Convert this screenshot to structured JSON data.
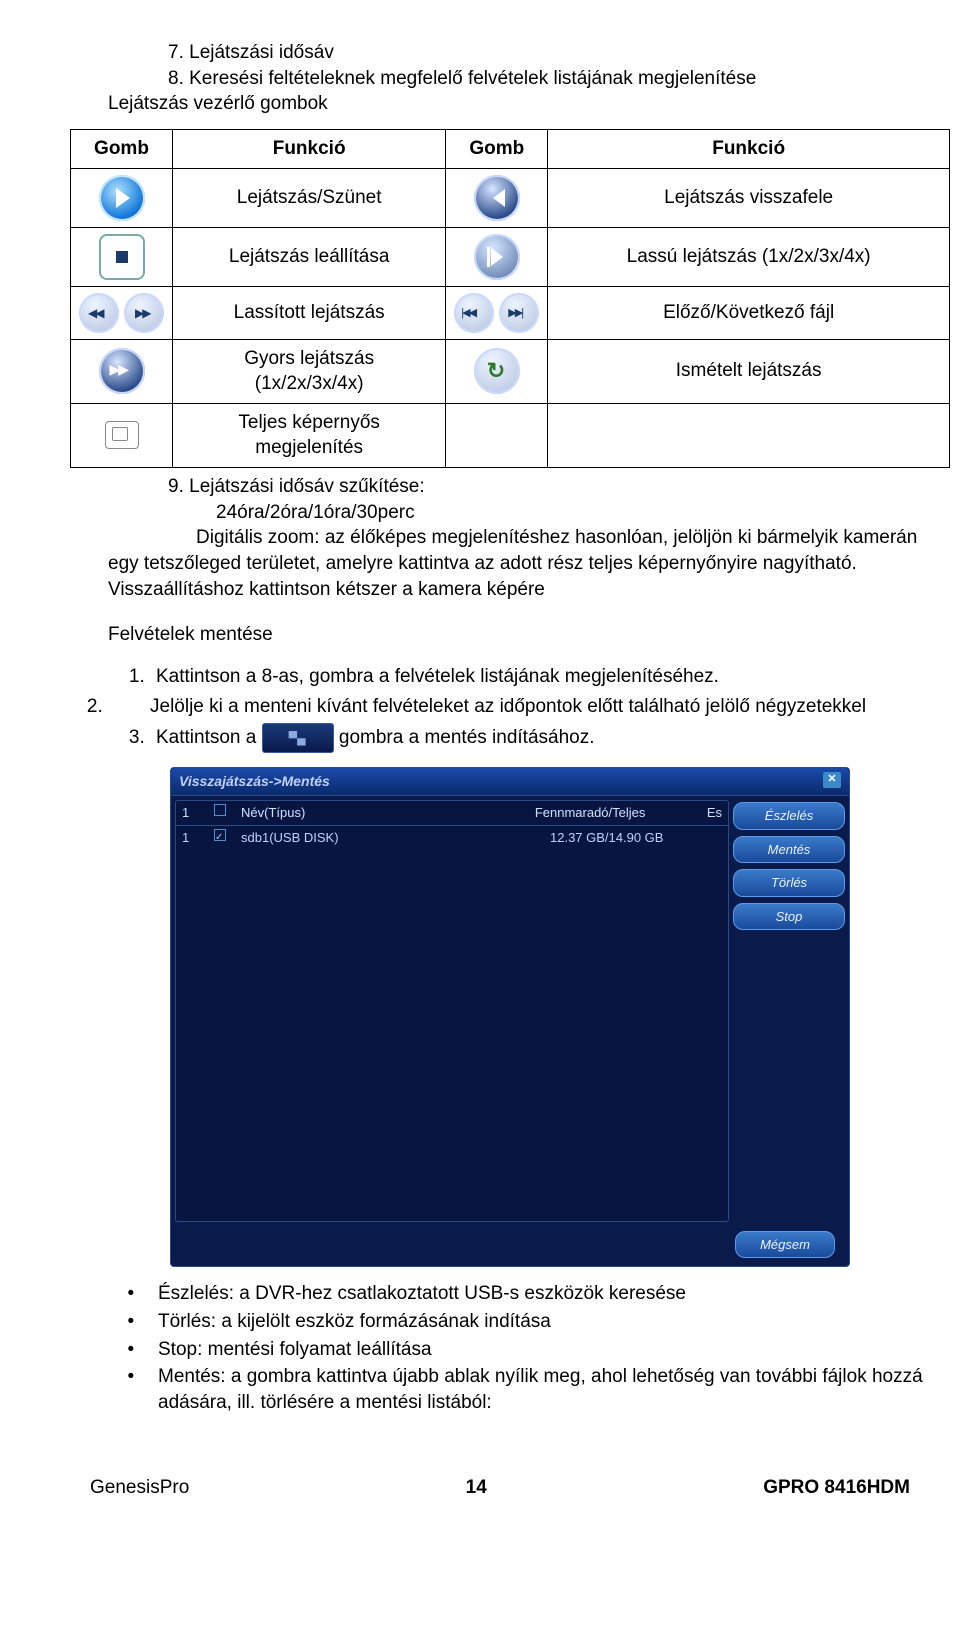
{
  "intro": {
    "line1": "7. Lejátszási idősáv",
    "line2": "8. Keresési feltételeknek megfelelő felvételek listájának megjelenítése",
    "line3": "Lejátszás vezérlő gombok"
  },
  "table": {
    "h1": "Gomb",
    "h2": "Funkció",
    "h3": "Gomb",
    "h4": "Funkció",
    "r1c2": "Lejátszás/Szünet",
    "r1c4": "Lejátszás visszafele",
    "r2c2": "Lejátszás leállítása",
    "r2c4": "Lassú lejátszás (1x/2x/3x/4x)",
    "r3c2": "Lassított lejátszás",
    "r3c4": "Előző/Következő fájl",
    "r4c2": "Gyors lejátszás\n(1x/2x/3x/4x)",
    "r4c4": "Ismételt lejátszás",
    "r5c2": "Teljes képernyős\nmegjelenítés"
  },
  "after": {
    "num": "9.  Lejátszási idősáv szűkítése:",
    "indent": "24óra/2óra/1óra/30perc",
    "para": "Digitális zoom: az élőképes megjelenítéshez hasonlóan, jelöljön ki bármelyik kamerán egy tetszőleged területet, amelyre kattintva az adott rész teljes képernyőnyire nagyítható. Visszaállításhoz kattintson kétszer a kamera képére"
  },
  "section": "Felvételek mentése",
  "steps": {
    "s1": "Kattintson a 8-as, gombra a felvételek listájának megjelenítéséhez.",
    "s2": "Jelölje ki a menteni kívánt felvételeket az időpontok előtt található jelölő négyzetekkel",
    "s3a": "Kattintson a",
    "s3b": "gombra a mentés indításához."
  },
  "dialog": {
    "title": "Visszajátszás->Mentés",
    "head_idx": "1",
    "head_name": "Név(Típus)",
    "head_remain": "Fennmaradó/Teljes",
    "head_es": "Es",
    "row_idx": "1",
    "row_name": "sdb1(USB DISK)",
    "row_remain": "12.37 GB/14.90 GB",
    "btn1": "Észlelés",
    "btn2": "Mentés",
    "btn3": "Törlés",
    "btn4": "Stop",
    "btn5": "Mégsem"
  },
  "bullets": {
    "b1": "Észlelés: a DVR-hez csatlakoztatott USB-s eszközök keresése",
    "b2": "Törlés: a kijelölt eszköz formázásának indítása",
    "b3": "Stop: mentési folyamat leállítása",
    "b4": "Mentés: a gombra kattintva újabb ablak nyílik meg, ahol lehetőség van további fájlok hozzá adására, ill. törlésére a mentési listából:"
  },
  "footer": {
    "left": "GenesisPro",
    "mid": "14",
    "right": "GPRO 8416HDM"
  }
}
